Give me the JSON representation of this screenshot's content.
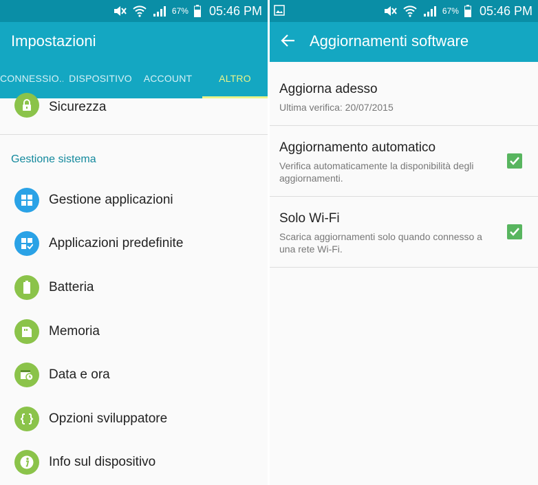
{
  "status_bar": {
    "battery_percent": "67%",
    "time": "05:46 PM"
  },
  "left": {
    "title": "Impostazioni",
    "tabs": [
      {
        "label": "CONNESSIO.."
      },
      {
        "label": "DISPOSITIVO"
      },
      {
        "label": "ACCOUNT"
      },
      {
        "label": "ALTRO",
        "active": true
      }
    ],
    "top_item": {
      "label": "Sicurezza",
      "icon": "lock-icon"
    },
    "section_header": "Gestione sistema",
    "items": [
      {
        "label": "Gestione applicazioni",
        "icon": "apps-grid-icon"
      },
      {
        "label": "Applicazioni predefinite",
        "icon": "default-apps-icon"
      },
      {
        "label": "Batteria",
        "icon": "battery-icon"
      },
      {
        "label": "Memoria",
        "icon": "memory-card-icon"
      },
      {
        "label": "Data e ora",
        "icon": "calendar-clock-icon"
      },
      {
        "label": "Opzioni sviluppatore",
        "icon": "braces-icon"
      },
      {
        "label": "Info sul dispositivo",
        "icon": "info-icon"
      }
    ]
  },
  "right": {
    "title": "Aggiornamenti software",
    "items": [
      {
        "title": "Aggiorna adesso",
        "subtitle": "Ultima verifica: 20/07/2015"
      },
      {
        "title": "Aggiornamento automatico",
        "subtitle": "Verifica automaticamente la disponibilità degli aggiornamenti.",
        "checked": true
      },
      {
        "title": "Solo Wi-Fi",
        "subtitle": "Scarica aggiornamenti solo quando connesso a una rete Wi-Fi.",
        "checked": true
      }
    ]
  },
  "colors": {
    "status_bar": "#0a8ea6",
    "app_bar": "#14a7c2",
    "tab_active": "#e9f48a",
    "section_header": "#13899d",
    "icon_green": "#8bc34a",
    "icon_blue": "#2aa2e6",
    "checkbox": "#58b55f"
  }
}
